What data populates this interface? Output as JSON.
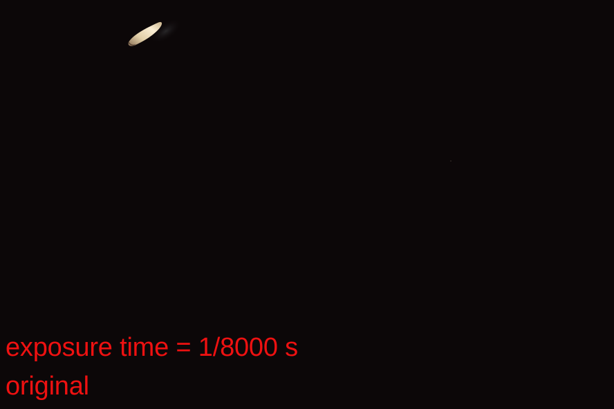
{
  "captions": {
    "exposure": "exposure time = 1/8000 s",
    "label": "original"
  },
  "colors": {
    "background": "#0c0708",
    "caption": "#ee1111",
    "object_highlight": "#f6e4c2",
    "object_body": "#d8c49a"
  }
}
